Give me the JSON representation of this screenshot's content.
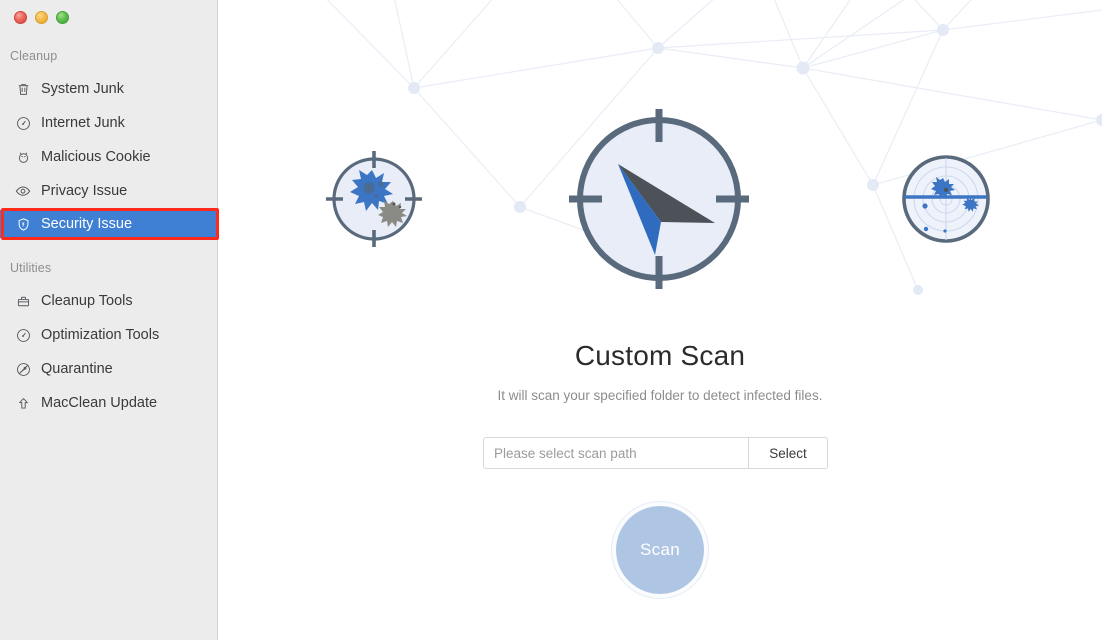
{
  "window": {
    "traffic_lights": [
      {
        "name": "close",
        "color": "#ee6a60"
      },
      {
        "name": "minimize",
        "color": "#f5bd4f"
      },
      {
        "name": "maximize",
        "color": "#62c254"
      }
    ]
  },
  "sidebar": {
    "background": "#ececec",
    "selected_color": "#3f7fd4",
    "annotation_color": "#fe2b1c",
    "sections": [
      {
        "label": "Cleanup"
      },
      {
        "label": "Utilities"
      }
    ],
    "cleanup_items": [
      {
        "label": "System Junk",
        "icon": "trash-icon",
        "selected": false
      },
      {
        "label": "Internet Junk",
        "icon": "gauge-icon",
        "selected": false
      },
      {
        "label": "Malicious Cookie",
        "icon": "cookie-icon",
        "selected": false
      },
      {
        "label": "Privacy Issue",
        "icon": "eye-icon",
        "selected": false
      },
      {
        "label": "Security Issue",
        "icon": "shield-icon",
        "selected": true
      }
    ],
    "utilities_items": [
      {
        "label": "Cleanup Tools",
        "icon": "briefcase-icon",
        "selected": false
      },
      {
        "label": "Optimization Tools",
        "icon": "gauge-icon",
        "selected": false
      },
      {
        "label": "Quarantine",
        "icon": "no-entry-icon",
        "selected": false
      },
      {
        "label": "MacClean Update",
        "icon": "up-arrow-icon",
        "selected": false
      }
    ]
  },
  "main": {
    "title": "Custom Scan",
    "subtitle": "It will scan your specified folder to detect infected files.",
    "scan_path": {
      "value": "",
      "placeholder": "Please select scan path"
    },
    "select_label": "Select",
    "scan_label": "Scan",
    "illustration": {
      "center_icon": "compass-crosshair-icon",
      "left_icon": "virus-target-icon",
      "right_icon": "radar-scan-icon",
      "background": "network-constellation",
      "accent_blue": "#3b75c4",
      "outline_gray": "#5a6a7d",
      "fill_light": "#e8edf7",
      "scan_button_color": "#afc5e4"
    }
  }
}
